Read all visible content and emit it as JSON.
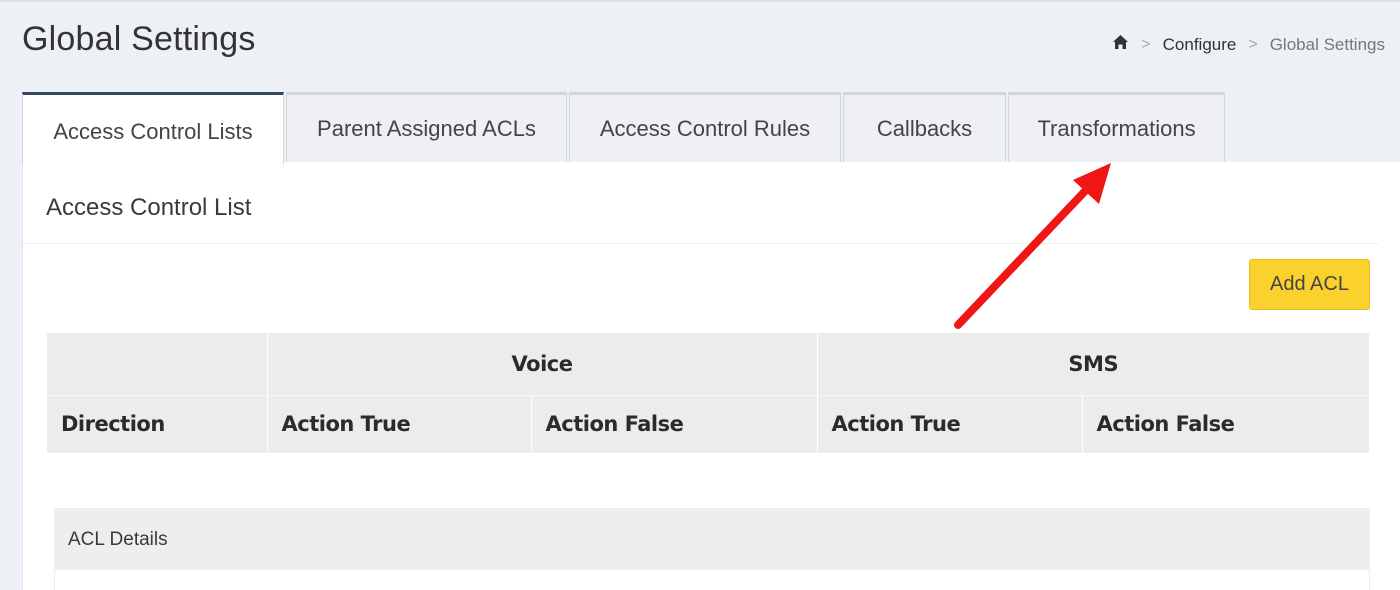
{
  "page": {
    "title": "Global Settings"
  },
  "breadcrumb": {
    "home_icon": "home-icon",
    "separator": ">",
    "items": [
      "Configure",
      "Global Settings"
    ]
  },
  "tabs": [
    {
      "label": "Access Control Lists",
      "active": true
    },
    {
      "label": "Parent Assigned ACLs",
      "active": false
    },
    {
      "label": "Access Control Rules",
      "active": false
    },
    {
      "label": "Callbacks",
      "active": false
    },
    {
      "label": "Transformations",
      "active": false
    }
  ],
  "panel": {
    "title": "Access Control List",
    "add_button_label": "Add ACL"
  },
  "table": {
    "groups": [
      "Voice",
      "SMS"
    ],
    "columns": [
      "Direction",
      "Action True",
      "Action False",
      "Action True",
      "Action False"
    ]
  },
  "details": {
    "title": "ACL Details"
  },
  "colors": {
    "accent_button": "#fbd12e",
    "active_tab_border": "#35495e",
    "annotation_arrow": "#f01616"
  }
}
